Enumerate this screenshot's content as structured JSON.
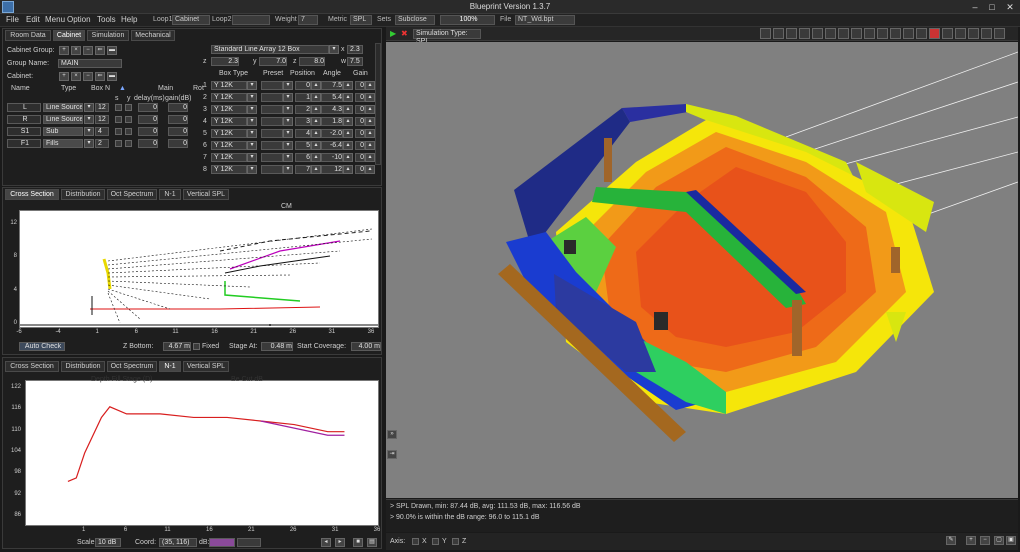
{
  "window": {
    "title": "Blueprint Version 1.3.7"
  },
  "menu": [
    "File",
    "Edit",
    "Menu",
    "Option",
    "Tools",
    "Help"
  ],
  "toolbar": {
    "loop1_label": "Loop1",
    "loop1_value": "Cabinet",
    "loop2_label": "Loop2",
    "loop2_value": "",
    "weight_label": "Weight",
    "weight_value": "7",
    "metric_label": "Metric",
    "metric_value": "SPL",
    "sets_label": "Sets",
    "sets_value": "Subclose",
    "percent": "100%",
    "file_label": "File",
    "file_value": "NT_Wd.bpt"
  },
  "left_tabs": [
    {
      "label": "Room Data",
      "active": false
    },
    {
      "label": "Cabinet",
      "active": true
    },
    {
      "label": "Simulation",
      "active": false
    },
    {
      "label": "Mechanical",
      "active": false
    }
  ],
  "cabinet": {
    "group_label": "Cabinet Group:",
    "group_name_label": "Group Name:",
    "group_name_value": "MAIN",
    "cabinet_label": "Cabinet:",
    "headers": [
      "Name",
      "Type",
      "Box N",
      "s",
      "y",
      "delay(ms)",
      "gain(dB)"
    ],
    "rows": [
      {
        "name": "L",
        "type": "Line Source",
        "n": "12",
        "delay": "0",
        "gain": "0"
      },
      {
        "name": "R",
        "type": "Line Source",
        "n": "12",
        "delay": "0",
        "gain": "0"
      },
      {
        "name": "S1",
        "type": "Sub",
        "n": "4",
        "delay": "0",
        "gain": "0"
      },
      {
        "name": "F1",
        "type": "Fills",
        "n": "2",
        "delay": "0",
        "gain": "0"
      }
    ],
    "main_label": "Main",
    "rot_label": "Rot",
    "selector_value": "Standard Line Array 12 Box",
    "x_value": "2.3",
    "y_value": "7.0",
    "z_value": "8.0",
    "w_value": "7.5",
    "box_headers": [
      "Box Type",
      "Preset",
      "Position",
      "Angle",
      "Gain"
    ],
    "boxes": [
      {
        "idx": "1",
        "type": "Y 12K",
        "pos": "0",
        "angle": "7.5",
        "gain": "0"
      },
      {
        "idx": "2",
        "type": "Y 12K",
        "pos": "1",
        "angle": "5.4",
        "gain": "0"
      },
      {
        "idx": "3",
        "type": "Y 12K",
        "pos": "2",
        "angle": "4.3",
        "gain": "0"
      },
      {
        "idx": "4",
        "type": "Y 12K",
        "pos": "3",
        "angle": "1.8",
        "gain": "0"
      },
      {
        "idx": "5",
        "type": "Y 12K",
        "pos": "4",
        "angle": "-2.0",
        "gain": "0"
      },
      {
        "idx": "6",
        "type": "Y 12K",
        "pos": "5",
        "angle": "-6.4",
        "gain": "0"
      },
      {
        "idx": "7",
        "type": "Y 12K",
        "pos": "6",
        "angle": "-10",
        "gain": "0"
      },
      {
        "idx": "8",
        "type": "Y 12K",
        "pos": "7",
        "angle": "12",
        "gain": "0"
      }
    ]
  },
  "upper_tabs": [
    {
      "label": "Cross Section",
      "active": true
    },
    {
      "label": "Distribution",
      "active": false
    },
    {
      "label": "Oct Spectrum",
      "active": false
    },
    {
      "label": "N-1",
      "active": false
    },
    {
      "label": "Vertical SPL",
      "active": false
    }
  ],
  "cross_section": {
    "title": "CM",
    "yticks": [
      "12",
      "8",
      "4",
      "0"
    ],
    "xticks": [
      "-6",
      "-4",
      "1",
      "6",
      "11",
      "16",
      "21",
      "26",
      "31",
      "36"
    ],
    "auto_check_label": "Auto Check",
    "z_bottom_label": "Z Bottom:",
    "z_bottom_value": "4.67 m",
    "fixed_label": "Fixed",
    "stage_label": "Stage At:",
    "stage_value": "0.48 m",
    "start_cov_label": "Start Coverage:",
    "start_cov_value": "4.00 m"
  },
  "lower_tabs": [
    {
      "label": "Cross Section",
      "active": false
    },
    {
      "label": "Distribution",
      "active": false
    },
    {
      "label": "Oct Spectrum",
      "active": false
    },
    {
      "label": "N-1",
      "active": true
    },
    {
      "label": "Vertical SPL",
      "active": false
    }
  ],
  "chart_data": {
    "type": "line",
    "title": "Depth Fill Stage (D)",
    "subtitle": "Be Cut dB",
    "yticks": [
      "122",
      "116",
      "110",
      "104",
      "98",
      "92",
      "86"
    ],
    "xticks": [
      "1",
      "6",
      "11",
      "16",
      "21",
      "26",
      "31",
      "36"
    ],
    "ylim": [
      86,
      122
    ],
    "xlim": [
      -6,
      36
    ],
    "series": [
      {
        "color": "#d81e1e",
        "x": [
          -1,
          0,
          1,
          3,
          4,
          6,
          10,
          14,
          18,
          22,
          26,
          30,
          32
        ],
        "y": [
          96,
          97,
          104,
          114,
          117,
          115,
          115,
          114,
          114,
          113,
          112,
          110,
          110
        ]
      },
      {
        "color": "#a020a0",
        "x": [
          22,
          26,
          30,
          32
        ],
        "y": [
          113,
          111,
          109,
          109
        ]
      }
    ]
  },
  "lower_controls": {
    "scale_label": "Scale:",
    "scale_value": "10 dB",
    "coord_label": "Coord:",
    "coord_value": "(35, 116)",
    "db_label": "dB:"
  },
  "view3d": {
    "sim_type": "Simulation Type: SPL",
    "status1": "> SPL Drawn, min: 87.44 dB, avg: 111.53 dB, max: 116.56 dB",
    "status2": "> 90.0% is within the dB range: 96.0 to 115.1 dB",
    "axis_label": "Axis:",
    "axis_x": "X",
    "axis_y": "Y",
    "axis_z": "Z"
  }
}
